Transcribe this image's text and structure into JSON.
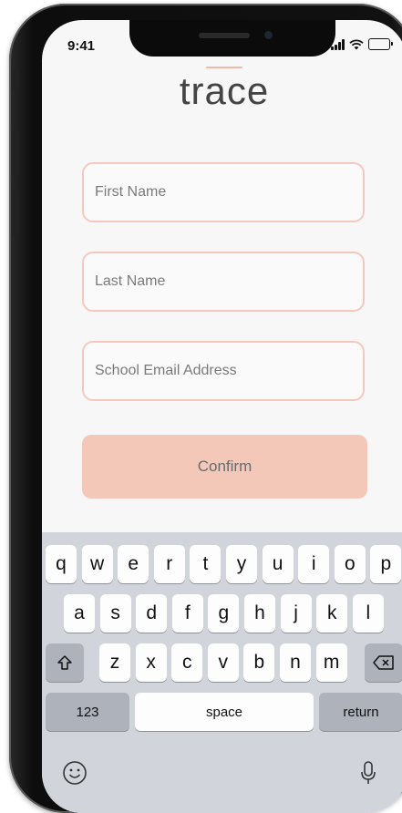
{
  "status_bar": {
    "time": "9:41",
    "icons": [
      "signal-icon",
      "wifi-icon",
      "battery-icon"
    ]
  },
  "app": {
    "logo": "trace"
  },
  "form": {
    "first_name": {
      "placeholder": "First Name",
      "value": ""
    },
    "last_name": {
      "placeholder": "Last Name",
      "value": ""
    },
    "email": {
      "placeholder": "School Email Address",
      "value": ""
    },
    "confirm_label": "Confirm"
  },
  "keyboard": {
    "row1": [
      "q",
      "w",
      "e",
      "r",
      "t",
      "y",
      "u",
      "i",
      "o",
      "p"
    ],
    "row2": [
      "a",
      "s",
      "d",
      "f",
      "g",
      "h",
      "j",
      "k",
      "l"
    ],
    "row3": [
      "z",
      "x",
      "c",
      "v",
      "b",
      "n",
      "m"
    ],
    "numbers_label": "123",
    "space_label": "space",
    "return_label": "return"
  },
  "colors": {
    "accent": "#f4c8b9",
    "field_border": "#f4c9bb",
    "keyboard_bg": "#d1d4da"
  }
}
